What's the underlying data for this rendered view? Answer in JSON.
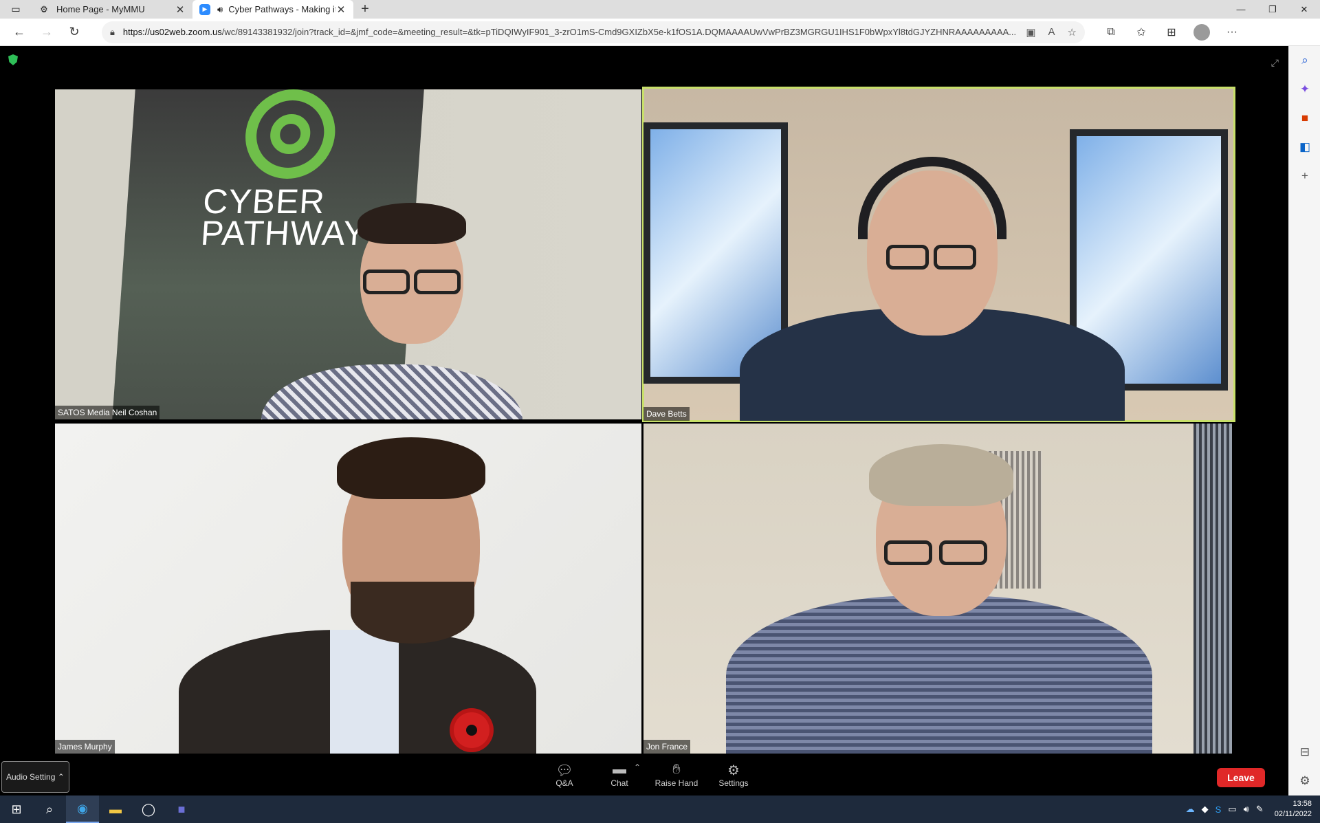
{
  "browser": {
    "tabs": [
      {
        "title": "Home Page - MyMMU",
        "active": false
      },
      {
        "title": "Cyber Pathways - Making it",
        "active": true
      }
    ],
    "url_host": "https://us02web.zoom.us",
    "url_rest": "/wc/89143381932/join?track_id=&jmf_code=&meeting_result=&tk=pTiDQIWyIF901_3-zrO1mS-Cmd9GXIZbX5e-k1fOS1A.DQMAAAAUwVwPrBZ3MGRGU1IHS1F0bWpxYl8tdGJYZHNRAAAAAAAAA..."
  },
  "meeting": {
    "participants": [
      {
        "name": "SATOS Media Neil Coshan",
        "active_speaker": false
      },
      {
        "name": "Dave Betts",
        "active_speaker": true
      },
      {
        "name": "James Murphy",
        "active_speaker": false
      },
      {
        "name": "Jon France",
        "active_speaker": false
      }
    ],
    "banner_text_1": "CYBER",
    "banner_text_2": "PATHWAYS"
  },
  "controls": {
    "audio_setting": "Audio Setting",
    "qa": "Q&A",
    "chat": "Chat",
    "raise_hand": "Raise Hand",
    "settings": "Settings",
    "leave": "Leave"
  },
  "taskbar": {
    "time": "13:58",
    "date": "02/11/2022"
  },
  "colors": {
    "speaker_border": "#c8e06a",
    "leave_button": "#e02828",
    "zoom_blue": "#2d8cff"
  }
}
